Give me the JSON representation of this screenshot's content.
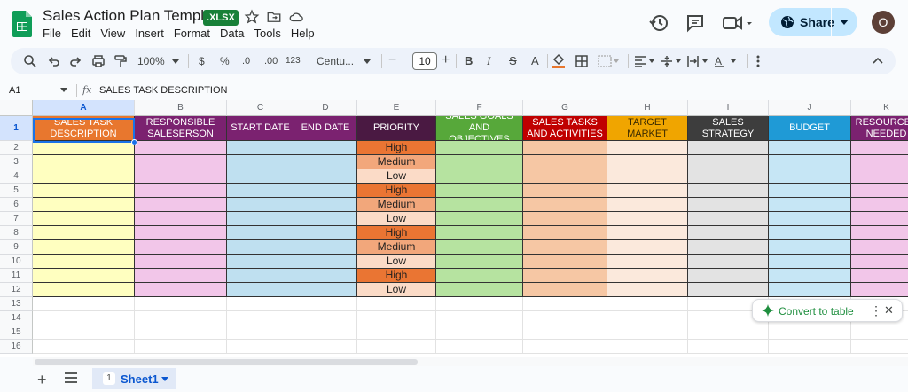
{
  "app": {
    "title": "Sales Action Plan Template",
    "badge": "XLSX",
    "menu": [
      "File",
      "Edit",
      "View",
      "Insert",
      "Format",
      "Data",
      "Tools",
      "Help"
    ],
    "share_label": "Share",
    "avatar_initial": "O"
  },
  "toolbar": {
    "zoom": "100%",
    "currency": "$",
    "percent": "%",
    "dec_decrease": ".0",
    "dec_increase": ".00",
    "number_format": "123",
    "font": "Centu...",
    "font_size": "10",
    "bold": "B",
    "italic": "I",
    "strike": "S",
    "text_color": "A"
  },
  "formula_bar": {
    "cell_ref": "A1",
    "fx": "fx",
    "content": "SALES TASK DESCRIPTION"
  },
  "columns": [
    "A",
    "B",
    "C",
    "D",
    "E",
    "F",
    "G",
    "H",
    "I",
    "J",
    "K"
  ],
  "rows": [
    "1",
    "2",
    "3",
    "4",
    "5",
    "6",
    "7",
    "8",
    "9",
    "10",
    "11",
    "12",
    "13",
    "14",
    "15",
    "16"
  ],
  "headers": [
    {
      "text": "SALES TASK DESCRIPTION",
      "bg": "#e8772e",
      "fill": "#ffffc0"
    },
    {
      "text": "RESPONSIBLE SALESERSON",
      "bg": "#7b2270",
      "fill": "#f2c6e9"
    },
    {
      "text": "START DATE",
      "bg": "#7b2270",
      "fill": "#bfe0f0"
    },
    {
      "text": "END DATE",
      "bg": "#7b2270",
      "fill": "#bfe0f0"
    },
    {
      "text": "PRIORITY",
      "bg": "#4a1942",
      "fill": "#f5d5c2"
    },
    {
      "text": "SALES GOALS AND OBJECTIVES",
      "bg": "#57a83a",
      "fill": "#b6e3a0"
    },
    {
      "text": "SALES TASKS AND ACTIVITIES",
      "bg": "#c00000",
      "fill": "#f6c7a4"
    },
    {
      "text": "TARGET MARKET",
      "bg": "#f0a500",
      "fill": "#fbe9dc"
    },
    {
      "text": "SALES STRATEGY",
      "bg": "#3d3d3d",
      "fill": "#e3e3e3"
    },
    {
      "text": "BUDGET",
      "bg": "#1f9ad6",
      "fill": "#c6e6f5"
    },
    {
      "text": "RESOURCES NEEDED",
      "bg": "#7b2270",
      "fill": "#f2c6e9"
    }
  ],
  "priorities": [
    {
      "label": "High",
      "color": "#ea7533"
    },
    {
      "label": "Medium",
      "color": "#f2a77b"
    },
    {
      "label": "Low",
      "color": "#fbdbc7"
    },
    {
      "label": "High",
      "color": "#ea7533"
    },
    {
      "label": "Medium",
      "color": "#f2a77b"
    },
    {
      "label": "Low",
      "color": "#fbdbc7"
    },
    {
      "label": "High",
      "color": "#ea7533"
    },
    {
      "label": "Medium",
      "color": "#f2a77b"
    },
    {
      "label": "Low",
      "color": "#fbdbc7"
    },
    {
      "label": "High",
      "color": "#ea7533"
    },
    {
      "label": "Low",
      "color": "#fbdbc7"
    }
  ],
  "sheet_tab": {
    "number": "1",
    "name": "Sheet1"
  },
  "chip": {
    "label": "Convert to table"
  }
}
